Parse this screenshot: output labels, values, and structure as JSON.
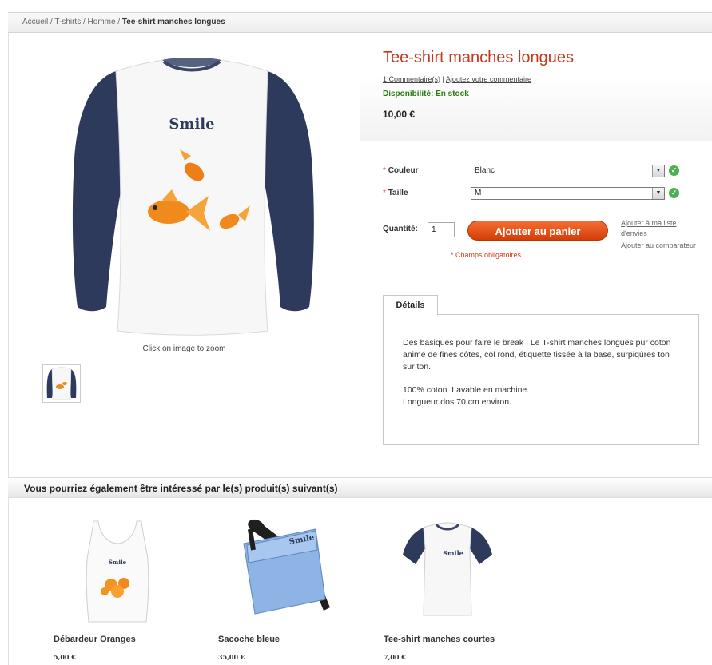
{
  "breadcrumb": {
    "home": "Accueil",
    "sep": "/",
    "cat1": "T-shirts",
    "cat2": "Homme",
    "current": "Tee-shirt manches longues"
  },
  "product": {
    "title": "Tee-shirt manches longues",
    "reviews_link": "1 Commentaire(s)",
    "review_sep": "|",
    "add_review_link": "Ajoutez votre commentaire",
    "availability": "Disponibilité: En stock",
    "price": "10,00 €",
    "image_print": "Smile",
    "zoom_hint": "Click on image to zoom"
  },
  "options": {
    "required_marker": "*",
    "color_label": "Couleur",
    "color_value": "Blanc",
    "size_label": "Taille",
    "size_value": "M"
  },
  "purchase": {
    "qty_label": "Quantité:",
    "qty_value": "1",
    "add_to_cart": "Ajouter au panier",
    "required_note": "* Champs obligatoires",
    "wishlist_link": "Ajouter à ma liste d'envies",
    "compare_link": "Ajouter au comparateur"
  },
  "details": {
    "tab_label": "Détails",
    "paragraph1": "Des basiques pour faire le break ! Le T-shirt manches longues pur coton animé de fines côtes, col rond, étiquette tissée à la base, surpiqûres ton sur ton.",
    "paragraph2_line1": "100% coton. Lavable en machine.",
    "paragraph2_line2": "Longueur dos 70 cm environ."
  },
  "related": {
    "heading": "Vous pourriez également être intéressé par le(s) produit(s) suivant(s)",
    "items": [
      {
        "name": "Débardeur Oranges",
        "price": "5,00 €",
        "print": "Smile"
      },
      {
        "name": "Sacoche bleue",
        "price": "35,00 €",
        "print": "Smile"
      },
      {
        "name": "Tee-shirt manches courtes",
        "price": "7,00 €",
        "print": "Smile"
      }
    ]
  },
  "colors": {
    "title": "#c8371b",
    "in_stock": "#2a7a16",
    "cta": "#e24f12",
    "navy": "#2d3a5c"
  }
}
